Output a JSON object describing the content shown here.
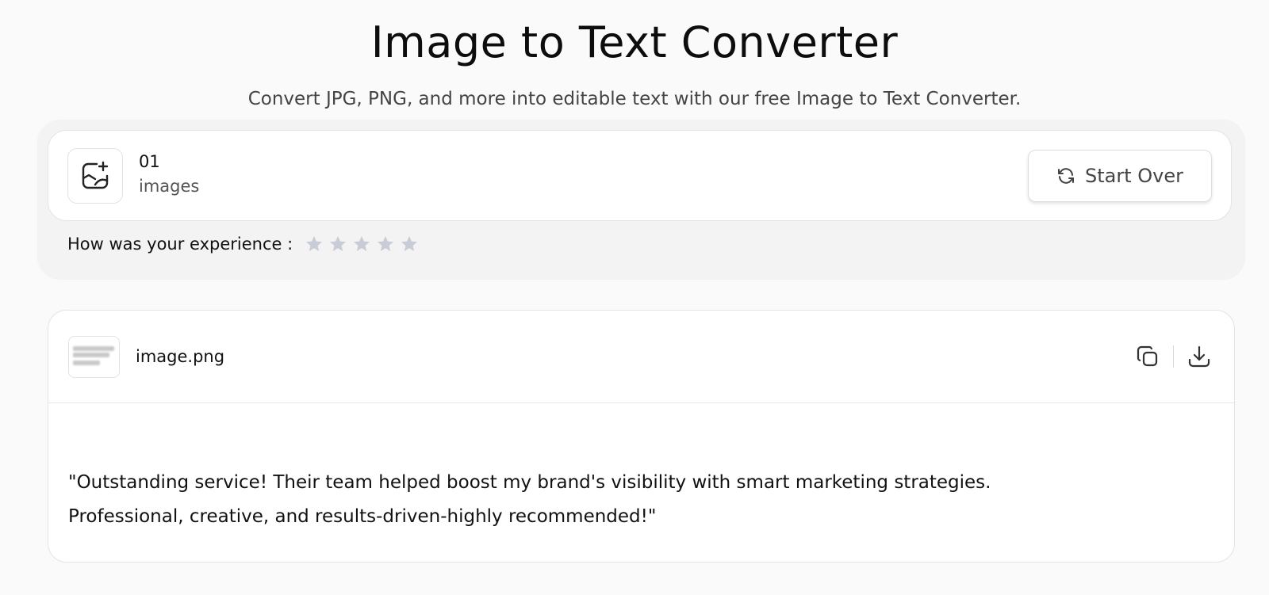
{
  "header": {
    "title": "Image to Text Converter",
    "subtitle": "Convert JPG, PNG, and more into editable text with our free Image to Text Converter."
  },
  "upload_summary": {
    "count": "01",
    "count_label": "images",
    "start_over_label": "Start Over"
  },
  "rating": {
    "label": "How was your experience :",
    "max_stars": 5,
    "selected_stars": 0,
    "star_color": "#c8ccd6"
  },
  "result": {
    "file_name": "image.png",
    "text_lines": [
      "\"Outstanding service! Their team helped boost my brand's visibility with smart marketing strategies.",
      "Professional, creative, and results-driven-highly recommended!\""
    ],
    "actions": [
      "copy-icon",
      "download-icon"
    ]
  }
}
